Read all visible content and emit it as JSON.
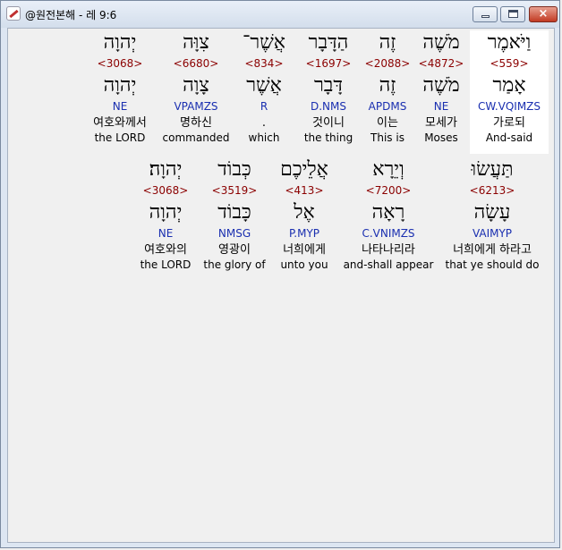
{
  "window": {
    "title": "@원전본해 - 레 9:6",
    "buttons": {
      "minimize": "minimize",
      "maximize": "maximize",
      "close": "×"
    }
  },
  "verse": {
    "row1": [
      {
        "heb": "וַיֹּאמֶר",
        "strong": "<559>",
        "lex": "אָמַר",
        "morph": "CW.VQIMZS",
        "korean": "가로되",
        "english": "And-said"
      },
      {
        "heb": "מֹשֶׁה",
        "strong": "<4872>",
        "lex": "מֹשֶׁה",
        "morph": "NE",
        "korean": "모세가",
        "english": "Moses"
      },
      {
        "heb": "זֶה",
        "strong": "<2088>",
        "lex": "זֶה",
        "morph": "APDMS",
        "korean": "이는",
        "english": "This is"
      },
      {
        "heb": "הַדָּבָר",
        "strong": "<1697>",
        "lex": "דָּבָר",
        "morph": "D.NMS",
        "korean": "것이니",
        "english": "the thing"
      },
      {
        "heb": "אֲשֶׁר־",
        "strong": "<834>",
        "lex": "אֲשֶׁר",
        "morph": "R",
        "korean": ".",
        "english": "which"
      },
      {
        "heb": "צִוָּה",
        "strong": "<6680>",
        "lex": "צָוָה",
        "morph": "VPAMZS",
        "korean": "명하신",
        "english": "commanded"
      },
      {
        "heb": "יְהוָה",
        "strong": "<3068>",
        "lex": "יְהוָה",
        "morph": "NE",
        "korean": "여호와께서",
        "english": "the LORD"
      }
    ],
    "row2": [
      {
        "heb": "תַּעֲשׂוּ",
        "strong": "<6213>",
        "lex": "עָשָׂה",
        "morph": "VAIMYP",
        "korean": "너희에게 하라고",
        "english": "that ye should do"
      },
      {
        "heb": "וְיֵרָא",
        "strong": "<7200>",
        "lex": "רָאָה",
        "morph": "C.VNIMZS",
        "korean": "나타나리라",
        "english": "and-shall appear"
      },
      {
        "heb": "אֲלֵיכֶם",
        "strong": "<413>",
        "lex": "אֶל",
        "morph": "P.MYP",
        "korean": "너희에게",
        "english": "unto you"
      },
      {
        "heb": "כְּבוֹד",
        "strong": "<3519>",
        "lex": "כָּבוֹד",
        "morph": "NMSG",
        "korean": "영광이",
        "english": "the glory of"
      },
      {
        "heb": "יְהוָה׃",
        "strong": "<3068>",
        "lex": "יְהוָה",
        "morph": "NE",
        "korean": "여호와의",
        "english": "the LORD"
      }
    ]
  },
  "colors": {
    "strong": "#8b0000",
    "morph": "#1a2fb0",
    "highlight": "#ffffff"
  }
}
